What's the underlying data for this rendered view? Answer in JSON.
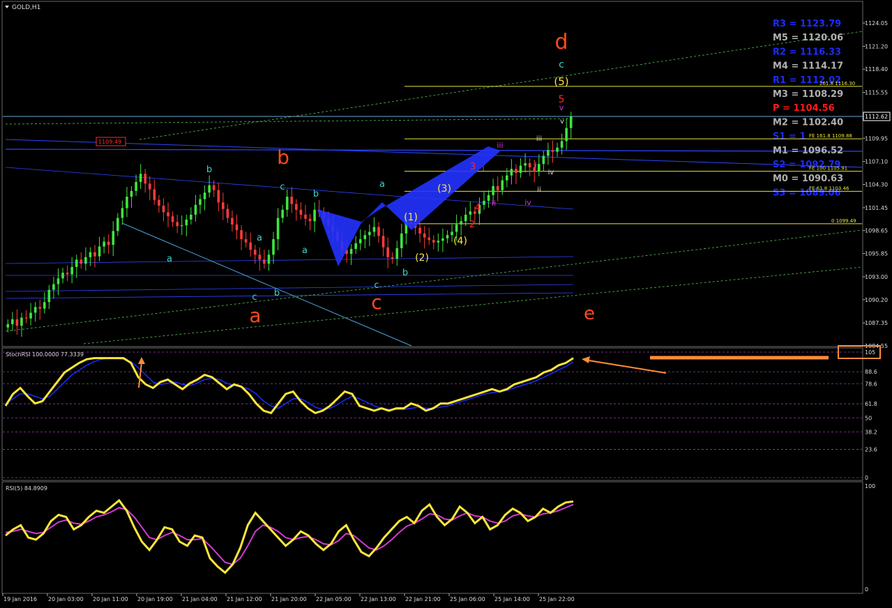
{
  "window": {
    "title": "GOLD,H1"
  },
  "price_axis": {
    "ticks": [
      "1124.05",
      "1121.20",
      "1118.40",
      "1115.55",
      "1112.70",
      "1109.95",
      "1107.10",
      "1104.30",
      "1101.45",
      "1098.65",
      "1095.85",
      "1093.00",
      "1090.20",
      "1087.35",
      "1084.55"
    ],
    "current_price": "1112.62"
  },
  "stoch_axis": {
    "ticks": [
      "105",
      "88.6",
      "78.6",
      "61.8",
      "50",
      "38.2",
      "23.6",
      "0"
    ]
  },
  "rsi_axis": {
    "ticks": [
      "100",
      "0"
    ]
  },
  "time_axis": {
    "labels": [
      "19 Jan 2016",
      "20 Jan 03:00",
      "20 Jan 11:00",
      "20 Jan 19:00",
      "21 Jan 04:00",
      "21 Jan 12:00",
      "21 Jan 20:00",
      "22 Jan 05:00",
      "22 Jan 13:00",
      "22 Jan 21:00",
      "25 Jan 06:00",
      "25 Jan 14:00",
      "25 Jan 22:00"
    ]
  },
  "pivots": [
    {
      "label": "R3 = 1123.79",
      "price": 1123.79,
      "color": "#1a2cff"
    },
    {
      "label": "M5 = 1120.06",
      "price": 1120.06,
      "color": "#b0b0b0"
    },
    {
      "label": "R2 = 1116.33",
      "price": 1116.33,
      "color": "#1a2cff"
    },
    {
      "label": "M4 = 1114.17",
      "price": 1114.17,
      "color": "#b0b0b0"
    },
    {
      "label": "R1 = 1112.02",
      "price": 1112.02,
      "color": "#1a2cff"
    },
    {
      "label": "M3 = 1108.29",
      "price": 1108.29,
      "color": "#b0b0b0"
    },
    {
      "label": "P  = 1104.56",
      "price": 1104.56,
      "color": "#ff1a1a"
    },
    {
      "label": "M2 = 1102.40",
      "price": 1102.4,
      "color": "#b0b0b0"
    },
    {
      "label": "S1 = 1",
      "price": 1100.25,
      "color": "#1a2cff"
    },
    {
      "label": "M1 = 1096.52",
      "price": 1096.52,
      "color": "#b0b0b0"
    },
    {
      "label": "S2 = 1092.79",
      "price": 1092.79,
      "color": "#1a2cff"
    },
    {
      "label": "M0 = 1090.63",
      "price": 1090.63,
      "color": "#b0b0b0"
    },
    {
      "label": "S3 = 1089.06",
      "price": 1089.06,
      "color": "#1a2cff"
    }
  ],
  "fib_levels": [
    {
      "label": "261.8 1116.30",
      "price": 1116.3
    },
    {
      "label": "FE 161.8 1109.88",
      "price": 1109.88
    },
    {
      "label": "FE 100 1105.91",
      "price": 1105.91
    },
    {
      "label": "FE 61.8 1103.46",
      "price": 1103.46
    },
    {
      "label": "0 1099.49",
      "price": 1099.49
    }
  ],
  "price_tag": "1109.49",
  "wave_labels": {
    "big": [
      "d",
      "b",
      "a",
      "c",
      "e"
    ],
    "teal": [
      "c",
      "b",
      "c",
      "b",
      "a",
      "a",
      "a",
      "a",
      "c",
      "b",
      "c",
      "b"
    ],
    "yellow": [
      "(5)",
      "(3)",
      "(1)",
      "(4)",
      "(2)"
    ],
    "red": [
      "5",
      "3",
      "4",
      "2"
    ],
    "magenta": [
      "v",
      "iii",
      "ii",
      "iv",
      "i"
    ],
    "white": [
      "v",
      "iii",
      "iv",
      "ii",
      "i"
    ]
  },
  "stochrsi_label": "StochRSI 100.0000 77.3339",
  "rsi_label": "RSI(5) 84.8909",
  "chart_data": [
    {
      "type": "candlestick",
      "title": "GOLD,H1",
      "ylim": [
        1084.55,
        1124.05
      ],
      "closes": [
        1087.2,
        1087.8,
        1087.0,
        1088.0,
        1087.9,
        1088.6,
        1089.3,
        1089.1,
        1089.9,
        1091.4,
        1092.1,
        1092.8,
        1093.5,
        1093.3,
        1094.2,
        1095.1,
        1094.6,
        1095.4,
        1096.0,
        1095.5,
        1096.7,
        1097.3,
        1096.9,
        1098.6,
        1100.2,
        1101.4,
        1102.8,
        1103.5,
        1104.6,
        1105.6,
        1104.4,
        1103.7,
        1102.4,
        1101.7,
        1100.9,
        1100.4,
        1099.7,
        1099.2,
        1099.3,
        1100.0,
        1100.6,
        1101.8,
        1102.5,
        1103.3,
        1104.2,
        1103.6,
        1102.1,
        1101.3,
        1100.2,
        1099.4,
        1098.7,
        1097.6,
        1097.2,
        1096.3,
        1095.7,
        1095.1,
        1094.6,
        1095.7,
        1097.6,
        1100.2,
        1101.2,
        1102.8,
        1101.9,
        1101.2,
        1100.6,
        1100.1,
        1099.8,
        1101.2,
        1100.9,
        1100.1,
        1099.3,
        1098.5,
        1097.4,
        1096.3,
        1095.8,
        1096.4,
        1097.1,
        1097.6,
        1098.1,
        1098.5,
        1099.1,
        1098.0,
        1096.6,
        1095.4,
        1095.2,
        1096.5,
        1098.3,
        1100.2,
        1099.6,
        1099.0,
        1098.3,
        1097.8,
        1097.5,
        1097.2,
        1097.4,
        1097.7,
        1098.1,
        1098.5,
        1099.4,
        1099.8,
        1100.6,
        1101.0,
        1100.7,
        1101.8,
        1102.3,
        1103.0,
        1104.1,
        1103.6,
        1104.8,
        1105.4,
        1106.2,
        1105.7,
        1106.6,
        1106.9,
        1106.4,
        1105.9,
        1106.8,
        1107.8,
        1108.5,
        1108.3,
        1108.8,
        1109.6,
        1111.2,
        1112.6
      ]
    },
    {
      "type": "line",
      "title": "StochRSI 100.0000 77.3339",
      "ylim": [
        0,
        105
      ],
      "series": [
        {
          "name": "main",
          "values": [
            60,
            70,
            75,
            68,
            62,
            64,
            72,
            80,
            88,
            92,
            96,
            99,
            100,
            100,
            100,
            100,
            100,
            96,
            84,
            78,
            75,
            80,
            82,
            78,
            74,
            79,
            82,
            86,
            84,
            79,
            74,
            78,
            76,
            70,
            62,
            56,
            54,
            62,
            70,
            72,
            64,
            58,
            54,
            56,
            60,
            66,
            72,
            70,
            60,
            58,
            56,
            58,
            56,
            58,
            58,
            62,
            60,
            56,
            58,
            62,
            62,
            64,
            66,
            68,
            70,
            72,
            74,
            72,
            74,
            78,
            80,
            82,
            84,
            88,
            90,
            94,
            96,
            100
          ]
        },
        {
          "name": "signal",
          "values": [
            62,
            66,
            70,
            70,
            68,
            66,
            68,
            74,
            80,
            86,
            90,
            94,
            97,
            99,
            100,
            100,
            99,
            97,
            92,
            86,
            80,
            78,
            79,
            80,
            78,
            77,
            79,
            82,
            83,
            82,
            79,
            77,
            76,
            74,
            70,
            64,
            60,
            58,
            62,
            66,
            66,
            63,
            59,
            57,
            58,
            61,
            65,
            68,
            66,
            63,
            60,
            58,
            57,
            57,
            57,
            58,
            59,
            58,
            58,
            59,
            60,
            62,
            64,
            66,
            68,
            70,
            71,
            72,
            73,
            75,
            77,
            79,
            81,
            84,
            87,
            90,
            93,
            97
          ]
        }
      ]
    },
    {
      "type": "line",
      "title": "RSI(5) 84.8909",
      "ylim": [
        0,
        100
      ],
      "series": [
        {
          "name": "main",
          "values": [
            52,
            58,
            62,
            50,
            48,
            54,
            66,
            72,
            70,
            58,
            62,
            70,
            76,
            74,
            80,
            86,
            76,
            60,
            46,
            38,
            48,
            60,
            58,
            46,
            42,
            52,
            50,
            30,
            22,
            16,
            24,
            40,
            62,
            74,
            66,
            58,
            50,
            42,
            48,
            56,
            52,
            44,
            38,
            44,
            56,
            62,
            48,
            36,
            32,
            40,
            50,
            58,
            66,
            70,
            64,
            76,
            82,
            70,
            62,
            68,
            80,
            74,
            64,
            70,
            58,
            62,
            72,
            78,
            74,
            66,
            70,
            78,
            74,
            80,
            84,
            85
          ]
        },
        {
          "name": "avg",
          "values": [
            55,
            56,
            58,
            56,
            54,
            55,
            60,
            65,
            67,
            64,
            63,
            66,
            70,
            72,
            75,
            79,
            77,
            70,
            60,
            50,
            48,
            52,
            55,
            52,
            48,
            48,
            49,
            42,
            34,
            26,
            24,
            30,
            42,
            56,
            62,
            60,
            56,
            50,
            48,
            50,
            51,
            48,
            44,
            43,
            47,
            54,
            52,
            46,
            40,
            38,
            42,
            48,
            55,
            61,
            64,
            68,
            73,
            72,
            68,
            67,
            71,
            74,
            71,
            70,
            66,
            64,
            66,
            71,
            73,
            71,
            70,
            73,
            74,
            76,
            79,
            82
          ]
        }
      ]
    }
  ]
}
